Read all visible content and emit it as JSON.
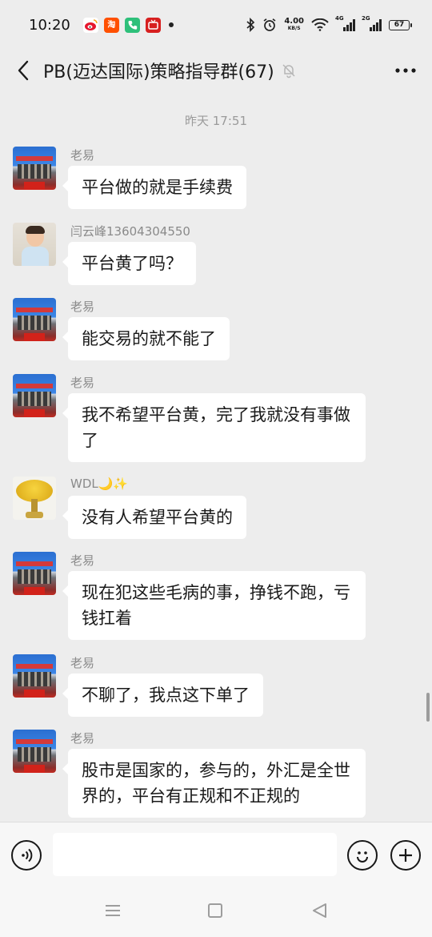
{
  "status_bar": {
    "time": "10:20",
    "net_speed": "4.00",
    "net_speed_unit": "KB/S",
    "sim1_label": "4G",
    "sim2_label": "2G",
    "battery": "67",
    "apps": [
      "weibo-icon",
      "taobao-icon",
      "phone-icon",
      "tv-icon"
    ]
  },
  "header": {
    "title": "PB(迈达国际)策略指导群(67)"
  },
  "messages": {
    "timestamp": "昨天 17:51",
    "items": [
      {
        "sender": "老易",
        "text": "平台做的就是手续费",
        "avatar": "building"
      },
      {
        "sender": "闫云峰13604304550",
        "text": "平台黄了吗？",
        "avatar": "boy"
      },
      {
        "sender": "老易",
        "text": "能交易的就不能了",
        "avatar": "building"
      },
      {
        "sender": "老易",
        "text": "我不希望平台黄，完了我就没有事做了",
        "avatar": "building"
      },
      {
        "sender": "WDL🌙✨",
        "text": "没有人希望平台黄的",
        "avatar": "tree"
      },
      {
        "sender": "老易",
        "text": "现在犯这些毛病的事，挣钱不跑，亏钱扛着",
        "avatar": "building"
      },
      {
        "sender": "老易",
        "text": "不聊了，我点这下单了",
        "avatar": "building"
      },
      {
        "sender": "老易",
        "text": "股市是国家的，参与的，外汇是全世界的，平台有正规和不正规的",
        "avatar": "building"
      }
    ]
  },
  "input_bar": {
    "value": "",
    "placeholder": ""
  },
  "colors": {
    "background": "#ededed",
    "bubble": "#ffffff",
    "text": "#191919",
    "sender": "#8a8a8a"
  }
}
